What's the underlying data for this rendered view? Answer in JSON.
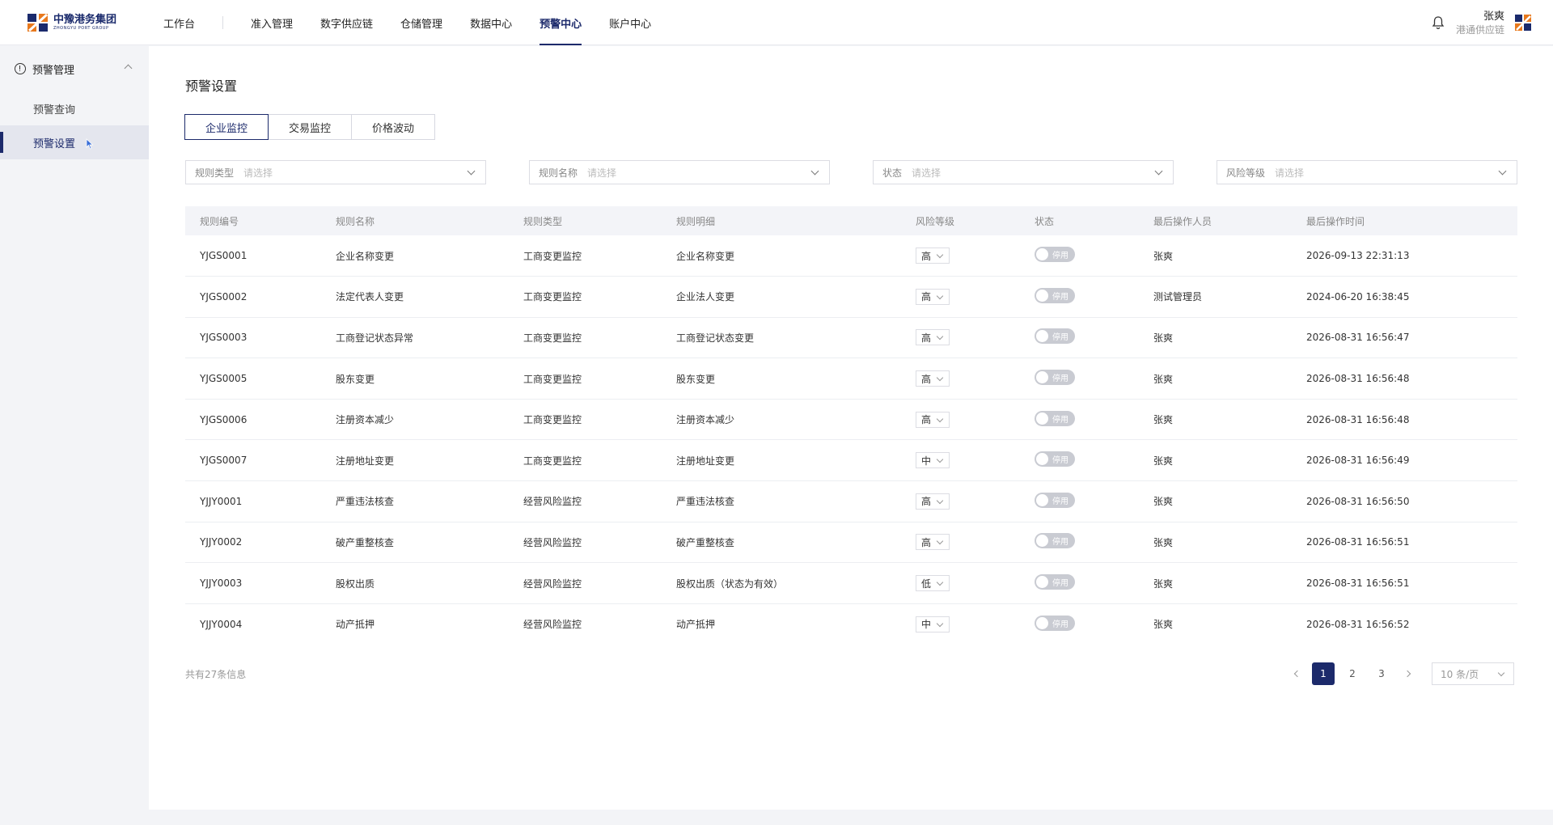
{
  "header": {
    "logo_cn": "中豫港务集团",
    "logo_en": "ZHONGYU PORT GROUP",
    "nav": [
      {
        "label": "工作台"
      },
      {
        "label": "准入管理"
      },
      {
        "label": "数字供应链"
      },
      {
        "label": "仓储管理"
      },
      {
        "label": "数据中心"
      },
      {
        "label": "预警中心",
        "active": true
      },
      {
        "label": "账户中心"
      }
    ],
    "user_name": "张爽",
    "user_org": "港通供应链"
  },
  "sidebar": {
    "group_label": "预警管理",
    "items": [
      {
        "label": "预警查询"
      },
      {
        "label": "预警设置",
        "active": true
      }
    ]
  },
  "main": {
    "title": "预警设置",
    "tabs": [
      {
        "label": "企业监控",
        "active": true
      },
      {
        "label": "交易监控"
      },
      {
        "label": "价格波动"
      }
    ],
    "filters": [
      {
        "label": "规则类型",
        "placeholder": "请选择"
      },
      {
        "label": "规则名称",
        "placeholder": "请选择"
      },
      {
        "label": "状态",
        "placeholder": "请选择"
      },
      {
        "label": "风险等级",
        "placeholder": "请选择"
      }
    ],
    "table": {
      "columns": [
        "规则编号",
        "规则名称",
        "规则类型",
        "规则明细",
        "风险等级",
        "状态",
        "最后操作人员",
        "最后操作时间"
      ],
      "toggle_label": "停用",
      "rows": [
        {
          "code": "YJGS0001",
          "name": "企业名称变更",
          "type": "工商变更监控",
          "detail": "企业名称变更",
          "level": "高",
          "operator": "张爽",
          "time": "2026-09-13 22:31:13"
        },
        {
          "code": "YJGS0002",
          "name": "法定代表人变更",
          "type": "工商变更监控",
          "detail": "企业法人变更",
          "level": "高",
          "operator": "测试管理员",
          "time": "2024-06-20 16:38:45"
        },
        {
          "code": "YJGS0003",
          "name": "工商登记状态异常",
          "type": "工商变更监控",
          "detail": "工商登记状态变更",
          "level": "高",
          "operator": "张爽",
          "time": "2026-08-31 16:56:47"
        },
        {
          "code": "YJGS0005",
          "name": "股东变更",
          "type": "工商变更监控",
          "detail": "股东变更",
          "level": "高",
          "operator": "张爽",
          "time": "2026-08-31 16:56:48"
        },
        {
          "code": "YJGS0006",
          "name": "注册资本减少",
          "type": "工商变更监控",
          "detail": "注册资本减少",
          "level": "高",
          "operator": "张爽",
          "time": "2026-08-31 16:56:48"
        },
        {
          "code": "YJGS0007",
          "name": "注册地址变更",
          "type": "工商变更监控",
          "detail": "注册地址变更",
          "level": "中",
          "operator": "张爽",
          "time": "2026-08-31 16:56:49"
        },
        {
          "code": "YJJY0001",
          "name": "严重违法核查",
          "type": "经营风险监控",
          "detail": "严重违法核查",
          "level": "高",
          "operator": "张爽",
          "time": "2026-08-31 16:56:50"
        },
        {
          "code": "YJJY0002",
          "name": "破产重整核查",
          "type": "经营风险监控",
          "detail": "破产重整核查",
          "level": "高",
          "operator": "张爽",
          "time": "2026-08-31 16:56:51"
        },
        {
          "code": "YJJY0003",
          "name": "股权出质",
          "type": "经营风险监控",
          "detail": "股权出质（状态为有效）",
          "level": "低",
          "operator": "张爽",
          "time": "2026-08-31 16:56:51"
        },
        {
          "code": "YJJY0004",
          "name": "动产抵押",
          "type": "经营风险监控",
          "detail": "动产抵押",
          "level": "中",
          "operator": "张爽",
          "time": "2026-08-31 16:56:52"
        }
      ]
    },
    "total_text": "共有27条信息",
    "pagination": {
      "pages": [
        "1",
        "2",
        "3"
      ],
      "current": "1",
      "page_size": "10 条/页"
    }
  },
  "colors": {
    "brand": "#1c2a6b",
    "toggle_off": "#c9cbd2",
    "logo_orange": "#e8791d"
  },
  "icons": [
    "warning-circle-icon",
    "chevron-up-icon",
    "bell-icon",
    "chevron-down-icon",
    "chevron-left-icon",
    "chevron-right-icon",
    "cursor-icon"
  ]
}
